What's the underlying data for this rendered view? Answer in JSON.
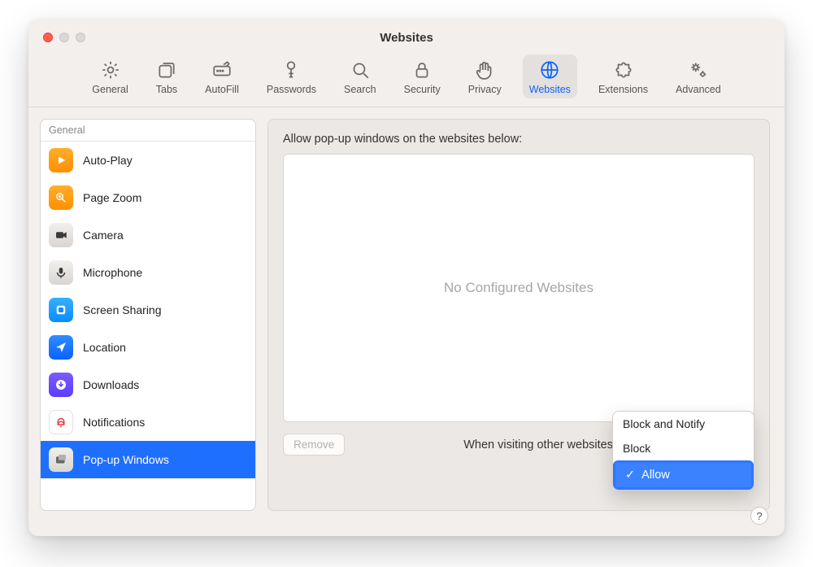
{
  "window": {
    "title": "Websites"
  },
  "toolbar": [
    {
      "id": "general",
      "label": "General",
      "icon": "gear-icon"
    },
    {
      "id": "tabs",
      "label": "Tabs",
      "icon": "tabs-icon"
    },
    {
      "id": "autofill",
      "label": "AutoFill",
      "icon": "autofill-icon"
    },
    {
      "id": "passwords",
      "label": "Passwords",
      "icon": "key-icon"
    },
    {
      "id": "search",
      "label": "Search",
      "icon": "search-icon"
    },
    {
      "id": "security",
      "label": "Security",
      "icon": "lock-icon"
    },
    {
      "id": "privacy",
      "label": "Privacy",
      "icon": "hand-icon"
    },
    {
      "id": "websites",
      "label": "Websites",
      "icon": "globe-icon",
      "active": true
    },
    {
      "id": "extensions",
      "label": "Extensions",
      "icon": "puzzle-icon"
    },
    {
      "id": "advanced",
      "label": "Advanced",
      "icon": "gears-icon"
    }
  ],
  "sidebar": {
    "section": "General",
    "items": [
      {
        "label": "Auto-Play",
        "icon": "play-icon",
        "style": "orange"
      },
      {
        "label": "Page Zoom",
        "icon": "zoom-icon",
        "style": "orange"
      },
      {
        "label": "Camera",
        "icon": "camera-icon",
        "style": "grey"
      },
      {
        "label": "Microphone",
        "icon": "mic-icon",
        "style": "grey"
      },
      {
        "label": "Screen Sharing",
        "icon": "screenshare-icon",
        "style": "blue"
      },
      {
        "label": "Location",
        "icon": "location-icon",
        "style": "bblue"
      },
      {
        "label": "Downloads",
        "icon": "download-icon",
        "style": "purple"
      },
      {
        "label": "Notifications",
        "icon": "bell-icon",
        "style": "white"
      },
      {
        "label": "Pop-up Windows",
        "icon": "popup-icon",
        "style": "grey",
        "selected": true
      }
    ]
  },
  "main": {
    "caption": "Allow pop-up windows on the websites below:",
    "placeholder": "No Configured Websites",
    "remove_label": "Remove",
    "other_label": "When visiting other websites:"
  },
  "dropdown": {
    "options": [
      "Block and Notify",
      "Block",
      "Allow"
    ],
    "selected": "Allow"
  },
  "help_label": "?"
}
